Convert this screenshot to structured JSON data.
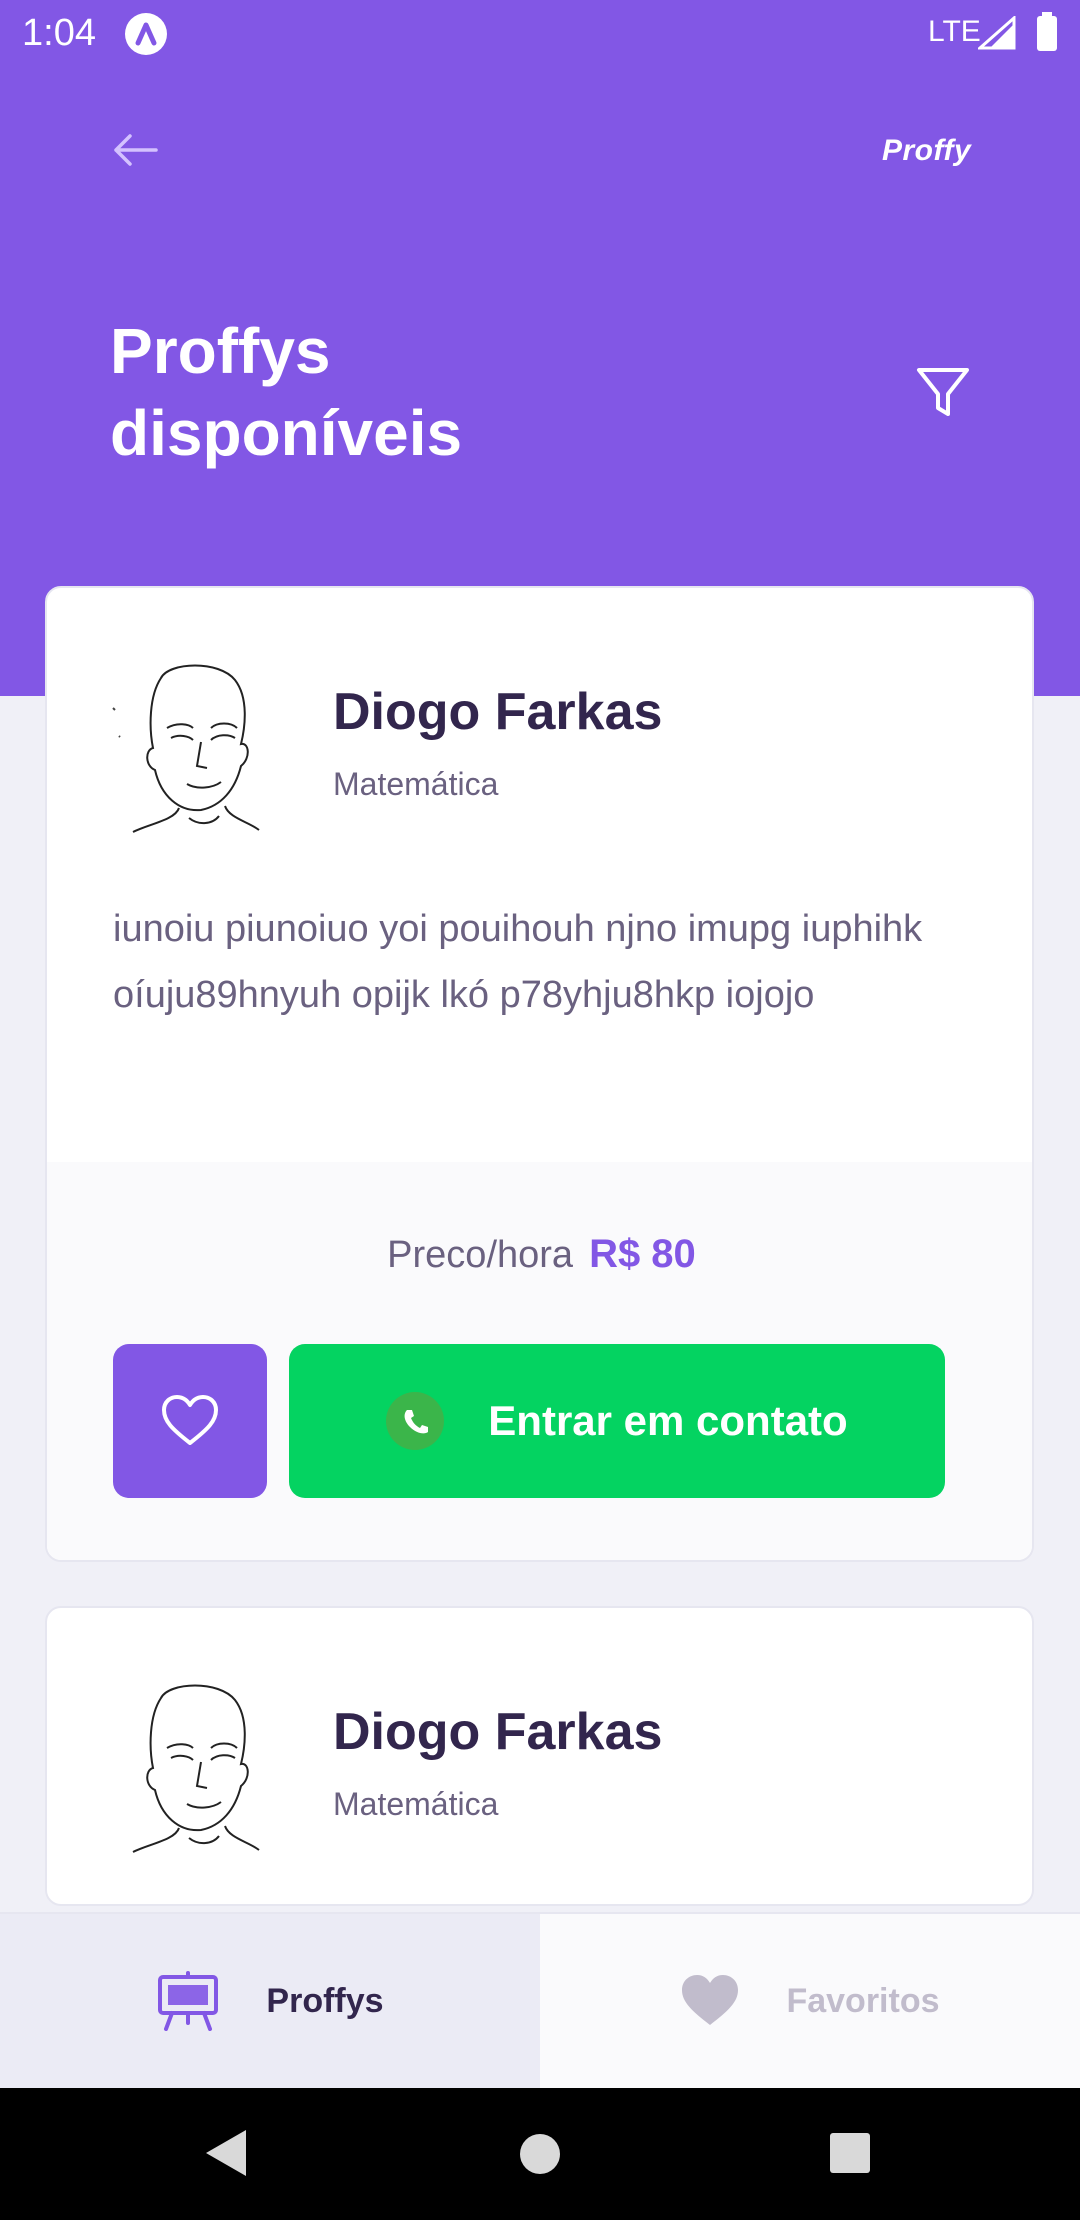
{
  "status_bar": {
    "time": "1:04",
    "network": "LTE"
  },
  "header": {
    "brand": "Proffy",
    "title_line1": "Proffys",
    "title_line2": "disponíveis"
  },
  "cards": [
    {
      "name": "Diogo Farkas",
      "subject": "Matemática",
      "bio": "iunoiu piunoiuo yoi pouihouh njno imupg iuphihk oíuju89hnyuh opijk lkó p78yhju8hkp iojojo",
      "price_label": "Preco/hora",
      "price_value": "R$ 80",
      "contact_label": "Entrar em contato"
    },
    {
      "name": "Diogo Farkas",
      "subject": "Matemática"
    }
  ],
  "tab_bar": {
    "proffys": "Proffys",
    "favoritos": "Favoritos"
  },
  "colors": {
    "primary": "#8257E5",
    "secondary": "#04D361",
    "title": "#32264D",
    "text": "#6A6180",
    "background": "#F0F0F7"
  }
}
